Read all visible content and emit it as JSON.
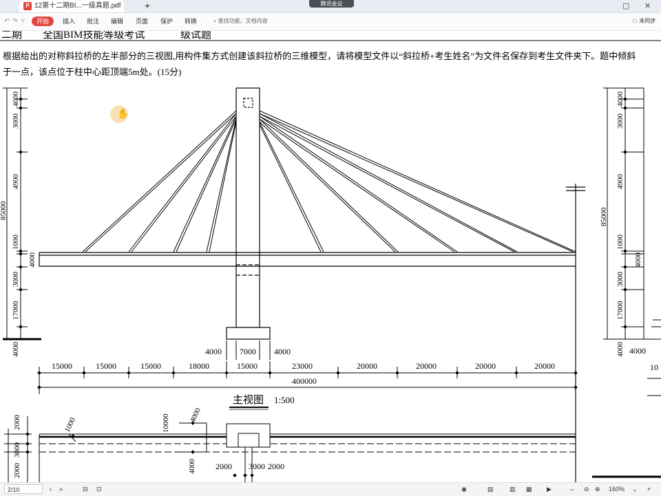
{
  "tabbar": {
    "doc_tab_title": "12第十二期BI...一级真题.pdf",
    "doc_type_badge": "P",
    "meeting_label": "腾讯会议",
    "new_tab_symbol": "+",
    "restore_symbol": "▢",
    "close_symbol": "✕"
  },
  "ribbon": {
    "start_label": "开始",
    "tabs": [
      "插入",
      "批注",
      "编辑",
      "页面",
      "保护",
      "转换"
    ],
    "search_placeholder": "查找功能、文档内容",
    "sync_label": "未同步"
  },
  "document": {
    "header_prefix": "二期",
    "header_mid": "全国BIM技能等级考试",
    "header_suffix": "级试题",
    "question_line1": "根据给出的对称斜拉桥的左半部分的三视图,用构件集方式创建该斜拉桥的三维模型，请将模型文件以“斜拉桥+考生姓名”为文件名保存到考生文件夹下。题中倾斜",
    "question_line2": "于一点，该点位于柱中心距顶端5m处。(15分)",
    "left_vertical_dims": [
      "4000",
      "3000",
      "4900",
      "1000",
      "4000",
      "3000",
      "17000",
      "4000"
    ],
    "left_cut_dim": "85000",
    "right_vertical_dims": [
      "4000",
      "3000",
      "4900",
      "1000",
      "4000",
      "3000",
      "17000",
      "4000"
    ],
    "right_total_dim": "85000",
    "base_dims": [
      "4000",
      "7000",
      "4000"
    ],
    "right_base_dims": [
      "4000",
      "10"
    ],
    "horizontal_dims": [
      "15000",
      "15000",
      "15000",
      "18000",
      "15000",
      "23000",
      "20000",
      "20000",
      "20000",
      "20000"
    ],
    "total_length": "400000",
    "view_title": "主视图",
    "view_scale": "1:500",
    "plan_vertical_dims": [
      "2000",
      "3000",
      "2000"
    ],
    "plan_slanted_dims": [
      "1000",
      "10000",
      "4000",
      "4000"
    ],
    "plan_bottom_dims": [
      "2000",
      "3000",
      "2000"
    ]
  },
  "statusbar": {
    "page_indicator": "2/10",
    "zoom_level": "160%"
  },
  "colors": {
    "accent_red": "#e2473f",
    "drawing_ink": "#000000",
    "meeting_bg": "#4a4f56"
  }
}
